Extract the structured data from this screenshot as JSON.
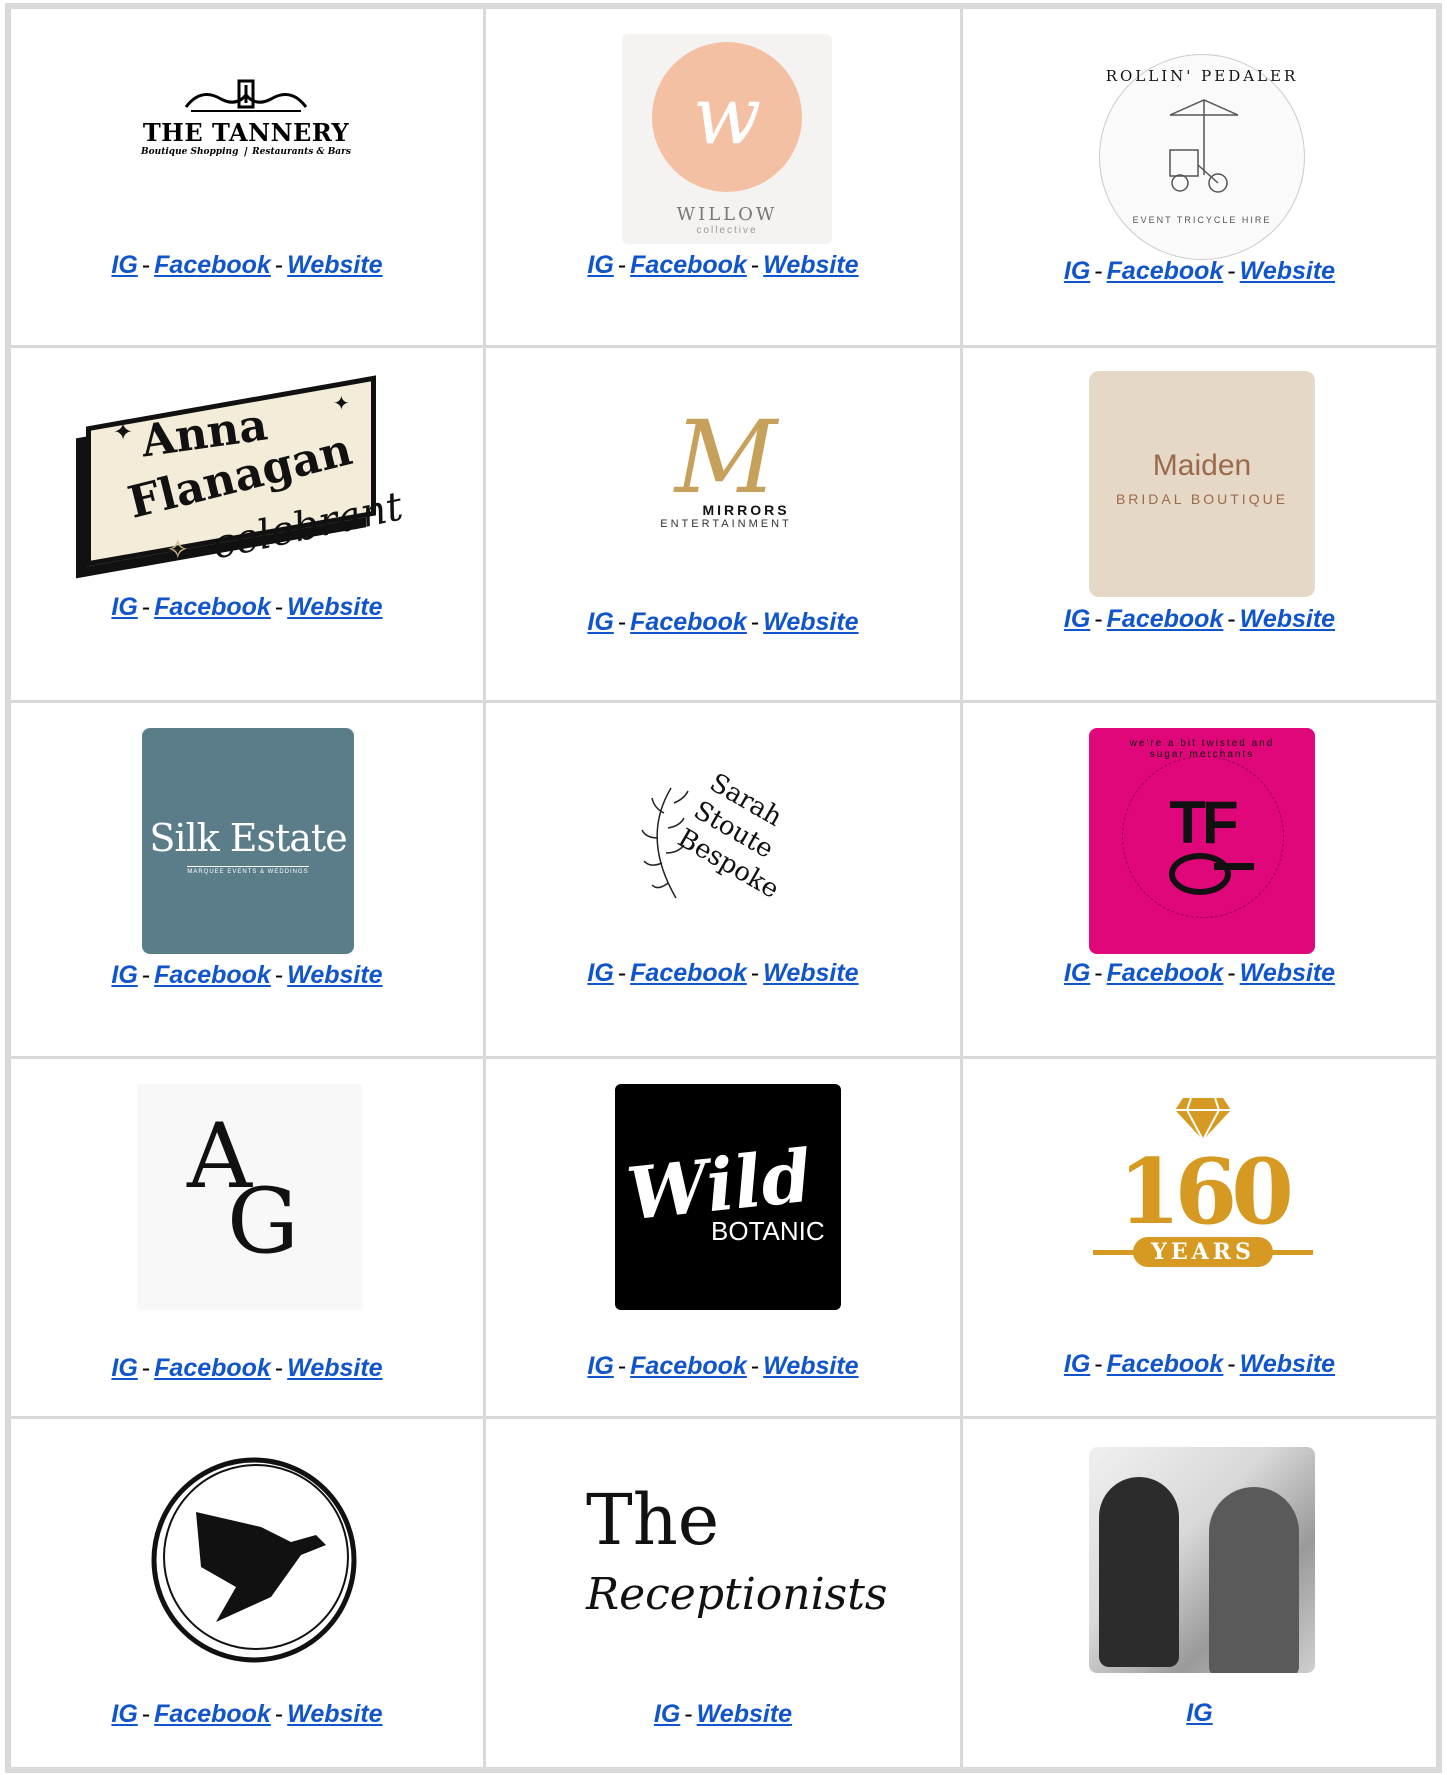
{
  "links": {
    "ig": "IG",
    "facebook": "Facebook",
    "website": "Website",
    "sep": "-"
  },
  "logos": {
    "tannery": {
      "title": "THE TANNERY",
      "subtitle": "Boutique Shopping ❘ Restaurants & Bars"
    },
    "willow": {
      "title": "WILLOW",
      "subtitle": "collective",
      "accent": "#f4c0a4"
    },
    "rollin": {
      "title": "ROLLIN' PEDALER",
      "subtitle": "EVENT TRICYCLE HIRE"
    },
    "anna": {
      "line1": "Anna",
      "line2": "Flanagan",
      "line3": "celebrant"
    },
    "mirrors": {
      "title": "MIRRORS",
      "subtitle": "ENTERTAINMENT",
      "accent": "#c6a15b"
    },
    "maiden": {
      "title": "Maiden",
      "subtitle": "BRIDAL BOUTIQUE",
      "accent": "#e6d8c6"
    },
    "silk": {
      "title": "Silk Estate",
      "subtitle": "MARQUEE EVENTS & WEDDINGS",
      "accent": "#5b7d8a"
    },
    "sarah": {
      "title": "Sarah Stoute Bespoke"
    },
    "tf": {
      "title": "TF",
      "ring": "we're a bit twisted and sugar merchants",
      "accent": "#e0077a"
    },
    "ag": {
      "l1": "A",
      "l2": "G"
    },
    "wild": {
      "title": "Wild",
      "subtitle": "BOTANIC"
    },
    "years": {
      "number": "160",
      "label": "YEARS",
      "accent": "#d69a22"
    },
    "receptionists": {
      "l1": "The",
      "l2": "Receptionists"
    }
  }
}
